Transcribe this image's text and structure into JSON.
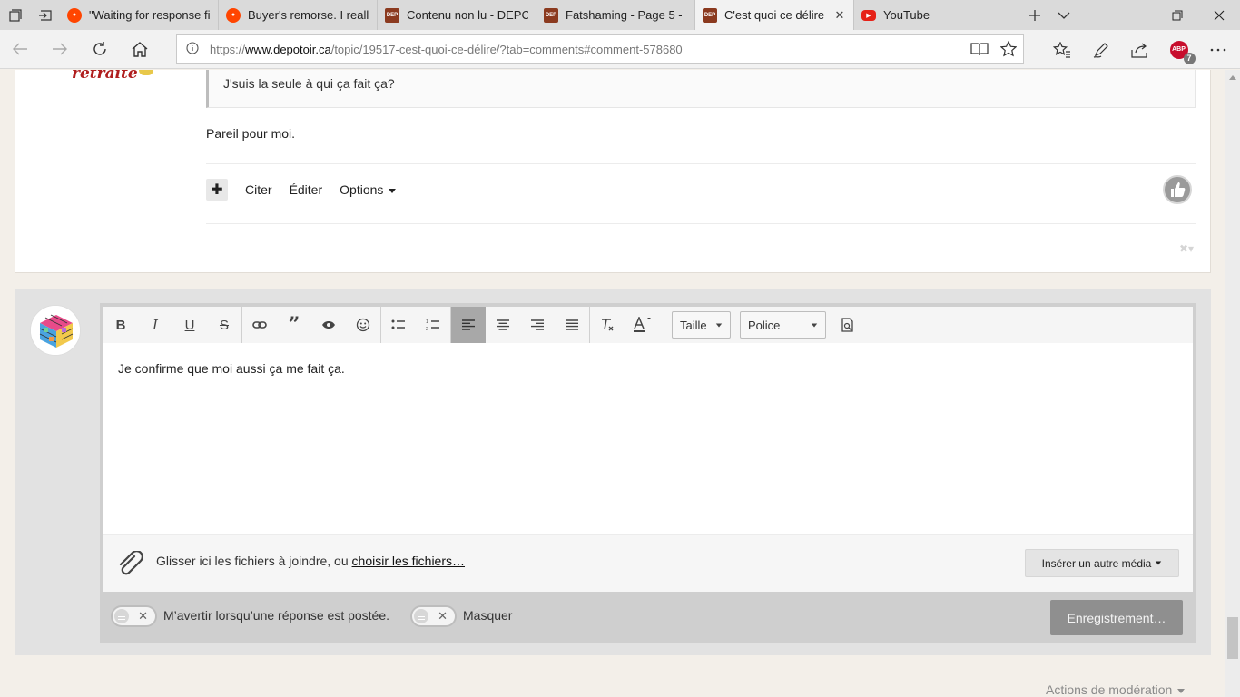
{
  "browser": {
    "tabs": [
      {
        "title": "\"Waiting for response fi",
        "favicon": "reddit-icon",
        "active": false
      },
      {
        "title": "Buyer's remorse. I really",
        "favicon": "reddit-icon",
        "active": false
      },
      {
        "title": "Contenu non lu - DEPC",
        "favicon": "depotoir-icon",
        "active": false
      },
      {
        "title": "Fatshaming - Page 5 - ",
        "favicon": "depotoir-icon",
        "active": false
      },
      {
        "title": "C'est quoi ce délire",
        "favicon": "depotoir-icon",
        "active": true
      },
      {
        "title": "YouTube",
        "favicon": "youtube-icon",
        "active": false
      }
    ],
    "url_prefix": "https://",
    "url_host": "www.depotoir.ca",
    "url_path": "/topic/19517-cest-quoi-ce-délire/?tab=comments#comment-578680",
    "abp_label": "ABP",
    "abp_count": "7"
  },
  "post": {
    "badge_text": "retraite",
    "quote_text": "J'suis la seule à qui ça fait ça?",
    "reply_text": "Pareil pour moi.",
    "actions": {
      "quote_label": "Citer",
      "edit_label": "Éditer",
      "options_label": "Options"
    }
  },
  "editor": {
    "toolbar": {
      "size_label": "Taille",
      "font_label": "Police"
    },
    "content": "Je confirme que moi aussi ça me fait ça.",
    "attach_text": "Glisser ici les fichiers à joindre, ou ",
    "attach_link": "choisir les fichiers…",
    "insert_media_label": "Insérer un autre média",
    "notify_label": "M’avertir lorsqu’une réponse est postée.",
    "hide_label": "Masquer",
    "save_label": "Enregistrement…"
  },
  "moderation_label": "Actions de modération"
}
